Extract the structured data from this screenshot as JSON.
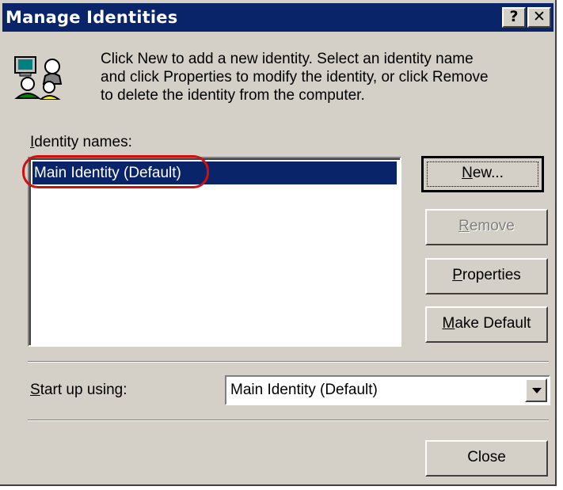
{
  "window": {
    "title": "Manage Identities",
    "help_label": "?",
    "close_label": "✕"
  },
  "intro": {
    "line1": "Click New to add a new identity.  Select an identity name",
    "line2": "and click Properties to modify the identity, or click Remove",
    "line3": "to delete the identity from the computer."
  },
  "identities": {
    "label_mnemonic": "I",
    "label_rest": "dentity names:",
    "items": [
      "Main Identity (Default)"
    ],
    "selected_index": 0
  },
  "buttons": {
    "new": {
      "mnemonic": "N",
      "rest": "ew..."
    },
    "remove": {
      "mnemonic": "R",
      "rest": "emove",
      "disabled": true
    },
    "properties": {
      "mnemonic": "P",
      "rest": "roperties"
    },
    "make_default": {
      "mnemonic": "M",
      "rest": "ake Default"
    },
    "close": {
      "label": "Close"
    }
  },
  "startup": {
    "label_mnemonic": "S",
    "label_rest": "tart up using:",
    "value": "Main Identity (Default)"
  },
  "colors": {
    "face": "#d4d0c8",
    "titlebar": "#0a246a",
    "selection": "#0a246a",
    "highlight_oval": "#d01010"
  },
  "icons": {
    "identities": "users-computer-icon",
    "dropdown": "chevron-down-icon"
  }
}
